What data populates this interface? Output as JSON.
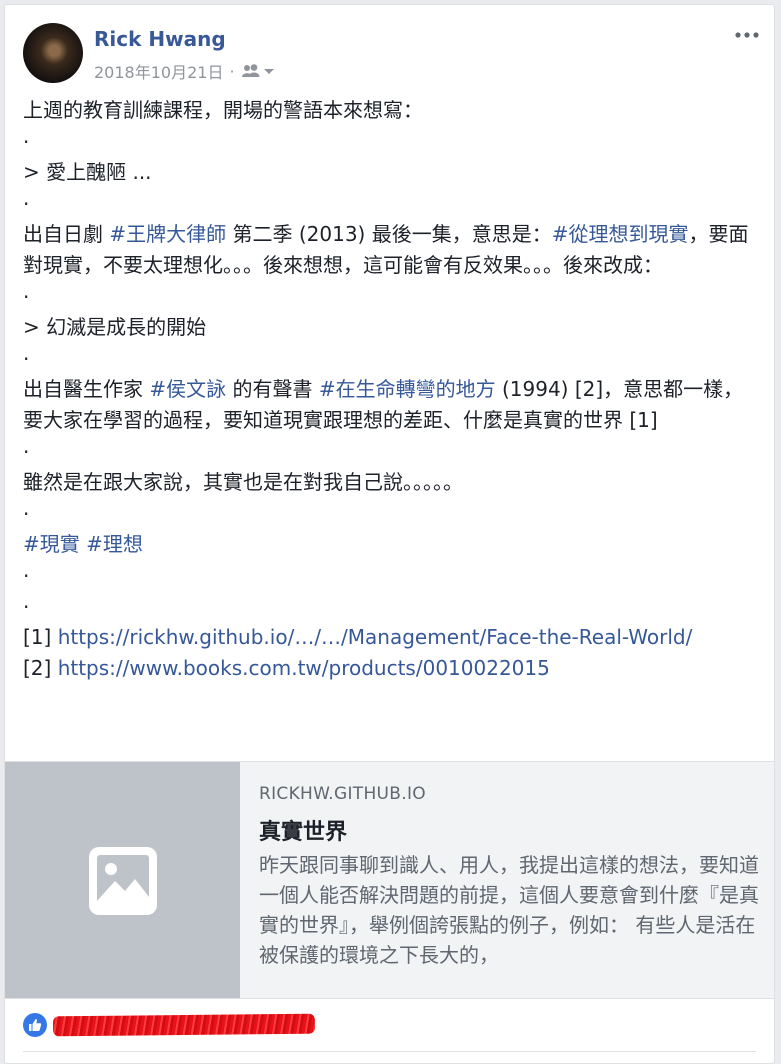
{
  "post": {
    "author": "Rick Hwang",
    "date": "2018年10月21日",
    "date_sep": "·",
    "audience_icon": "friends-icon",
    "more_icon": "ellipsis-icon",
    "lines": {
      "l1": "上週的教育訓練課程，開場的警語本來想寫：",
      "dot": ".",
      "quote1": "> 愛上醜陋 ...",
      "p1a": "出自日劇 ",
      "p1tag1": "#王牌大律師",
      "p1b": " 第二季 (2013) 最後一集，意思是：",
      "p1tag2": "#從理想到現實",
      "p1c": "，要面對現實，不要太理想化。。。後來想想，這可能會有反效果。。。後來改成：",
      "quote2": "> 幻滅是成長的開始",
      "p2a": "出自醫生作家 ",
      "p2tag1": "#侯文詠",
      "p2b": " 的有聲書 ",
      "p2tag2": "#在生命轉彎的地方",
      "p2c": " (1994) [2]，意思都一樣，要大家在學習的過程，要知道現實跟理想的差距、什麼是真實的世界 [1]",
      "p3": "雖然是在跟大家說，其實也是在對我自己說。。。。。",
      "tag_real": "#現實",
      "tag_ideal": "#理想",
      "ref1_label": "[1] ",
      "ref1_url": "https://rickhw.github.io/…/…/Management/Face-the-Real-World/",
      "ref2_label": "[2] ",
      "ref2_url": "https://www.books.com.tw/products/0010022015"
    }
  },
  "link_preview": {
    "domain": "RICKHW.GITHUB.IO",
    "title": "真實世界",
    "description": "昨天跟同事聊到識人、用人，我提出這樣的想法，要知道一個人能否解決問題的前提，這個人要意會到什麼『是真實的世界』，舉例個誇張點的例子，例如： 有些人是活在被保護的環境之下長大的，",
    "thumb_icon": "image-placeholder-icon"
  },
  "reactions": {
    "icon": "like-icon",
    "names_redacted": true
  },
  "colors": {
    "link": "#365899",
    "author": "#385898",
    "like": "#3578e5",
    "redaction": "#e8121a"
  }
}
